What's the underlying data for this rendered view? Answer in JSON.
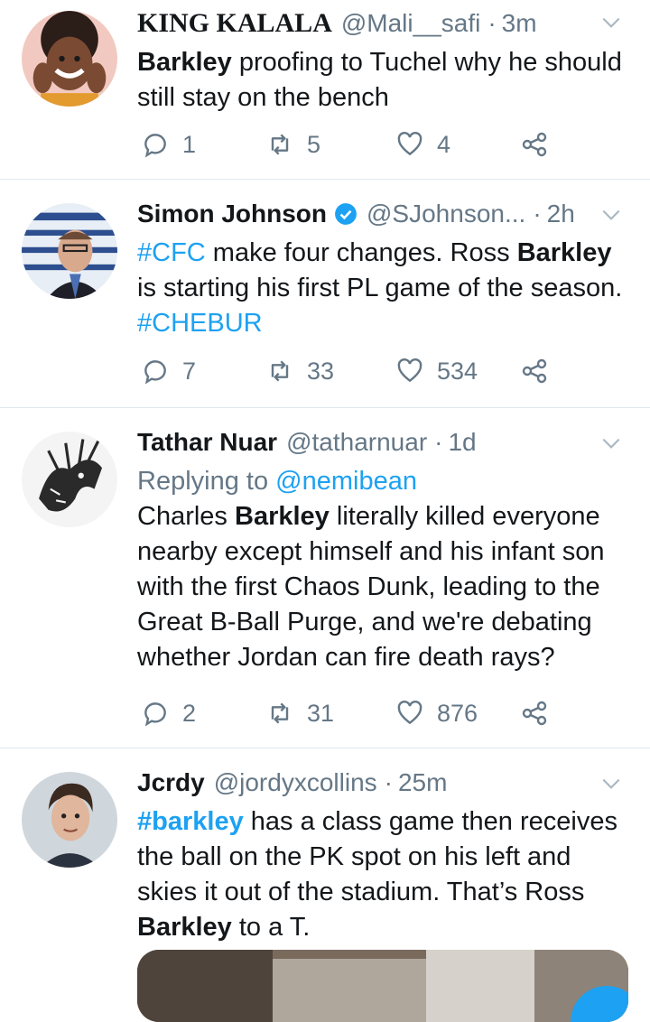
{
  "tweets": [
    {
      "name": "KING KALALA",
      "handle": "@Mali__safi",
      "sep": "·",
      "time": "3m",
      "text": [
        {
          "t": "Barkley",
          "s": "b"
        },
        {
          "t": " proofing to Tuchel why he should still stay on the bench",
          "s": ""
        }
      ],
      "replies": "1",
      "retweets": "5",
      "likes": "4"
    },
    {
      "name": "Simon Johnson",
      "handle": "@SJohnson...",
      "sep": "·",
      "time": "2h",
      "verified": true,
      "text": [
        {
          "t": "#CFC",
          "s": "tag"
        },
        {
          "t": " make four changes. Ross ",
          "s": ""
        },
        {
          "t": "Barkley",
          "s": "b"
        },
        {
          "t": " is starting his first PL game of the season. ",
          "s": ""
        },
        {
          "t": "#CHEBUR",
          "s": "tag"
        }
      ],
      "replies": "7",
      "retweets": "33",
      "likes": "534"
    },
    {
      "name": "Tathar Nuar",
      "handle": "@tatharnuar",
      "sep": "·",
      "time": "1d",
      "replying_prefix": "Replying to ",
      "replying_to": "@nemibean",
      "text": [
        {
          "t": "Charles ",
          "s": ""
        },
        {
          "t": "Barkley",
          "s": "b"
        },
        {
          "t": " literally killed everyone nearby except himself and his infant son with the first Chaos Dunk, leading to the Great B-Ball Purge, and we're debating whether Jordan can fire death rays?",
          "s": ""
        }
      ],
      "replies": "2",
      "retweets": "31",
      "likes": "876"
    },
    {
      "name": "Jcrdy",
      "handle": "@jordyxcollins",
      "sep": "·",
      "time": "25m",
      "text": [
        {
          "t": "#barkley",
          "s": "tag b"
        },
        {
          "t": " has a class game then receives the ball on the PK spot on his left and skies it out of the stadium. That’s Ross ",
          "s": ""
        },
        {
          "t": "Barkley",
          "s": "b"
        },
        {
          "t": " to a T.",
          "s": ""
        }
      ]
    }
  ],
  "icons": {
    "reply": "reply-icon",
    "retweet": "retweet-icon",
    "like": "heart-icon",
    "share": "share-icon",
    "menu": "chevron-down-icon",
    "verified": "verified-badge-icon"
  },
  "colors": {
    "text": "#14171a",
    "muted": "#657786",
    "accent": "#1da1f2",
    "divider": "#e1e8ed"
  }
}
